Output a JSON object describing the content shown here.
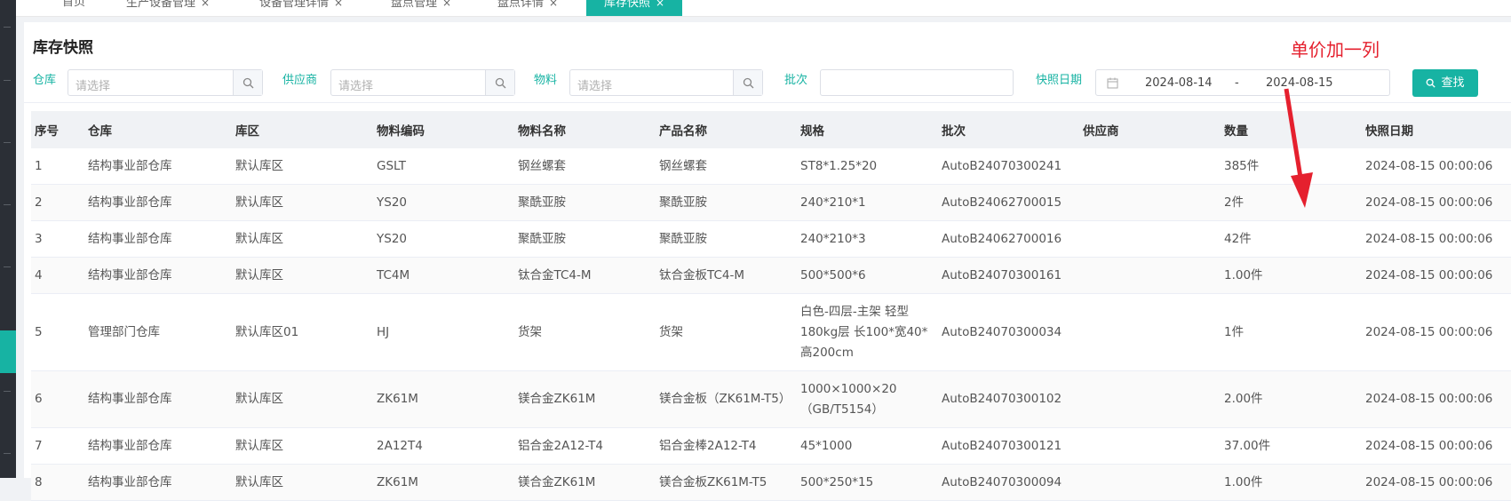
{
  "tabs": [
    {
      "label": "首页",
      "close": ""
    },
    {
      "label": "生产设备管理",
      "close": "×"
    },
    {
      "label": "设备管理详情",
      "close": "×"
    },
    {
      "label": "盘点管理",
      "close": "×"
    },
    {
      "label": "盘点详情",
      "close": "×"
    },
    {
      "label": "库存快照",
      "close": "×"
    }
  ],
  "page": {
    "title": "库存快照",
    "annotation": "单价加一列"
  },
  "filters": {
    "warehouse": {
      "label": "仓库",
      "placeholder": "请选择"
    },
    "supplier": {
      "label": "供应商",
      "placeholder": "请选择"
    },
    "material": {
      "label": "物料",
      "placeholder": "请选择"
    },
    "batch": {
      "label": "批次",
      "placeholder": ""
    },
    "snapshot_date": {
      "label": "快照日期",
      "start": "2024-08-14",
      "separator": "-",
      "end": "2024-08-15"
    },
    "search_label": "查找"
  },
  "table": {
    "headers": [
      "序号",
      "仓库",
      "库区",
      "物料编码",
      "物料名称",
      "产品名称",
      "规格",
      "批次",
      "供应商",
      "数量",
      "快照日期"
    ],
    "rows": [
      {
        "c0": "1",
        "c1": "结构事业部仓库",
        "c2": "默认库区",
        "c3": "GSLT",
        "c4": "钢丝螺套",
        "c5": "钢丝螺套",
        "c6": "ST8*1.25*20",
        "c7": "AutoB24070300241",
        "c8": "",
        "c9": "385件",
        "c10": "2024-08-15 00:00:06"
      },
      {
        "c0": "2",
        "c1": "结构事业部仓库",
        "c2": "默认库区",
        "c3": "YS20",
        "c4": "聚酰亚胺",
        "c5": "聚酰亚胺",
        "c6": "240*210*1",
        "c7": "AutoB24062700015",
        "c8": "",
        "c9": "2件",
        "c10": "2024-08-15 00:00:06"
      },
      {
        "c0": "3",
        "c1": "结构事业部仓库",
        "c2": "默认库区",
        "c3": "YS20",
        "c4": "聚酰亚胺",
        "c5": "聚酰亚胺",
        "c6": "240*210*3",
        "c7": "AutoB24062700016",
        "c8": "",
        "c9": "42件",
        "c10": "2024-08-15 00:00:06"
      },
      {
        "c0": "4",
        "c1": "结构事业部仓库",
        "c2": "默认库区",
        "c3": "TC4M",
        "c4": "钛合金TC4-M",
        "c5": "钛合金板TC4-M",
        "c6": "500*500*6",
        "c7": "AutoB24070300161",
        "c8": "",
        "c9": "1.00件",
        "c10": "2024-08-15 00:00:06"
      },
      {
        "c0": "5",
        "c1": "管理部门仓库",
        "c2": "默认库区01",
        "c3": "HJ",
        "c4": "货架",
        "c5": "货架",
        "c6": "白色-四层-主架 轻型180kg层 长100*宽40*高200cm",
        "c7": "AutoB24070300034",
        "c8": "",
        "c9": "1件",
        "c10": "2024-08-15 00:00:06"
      },
      {
        "c0": "6",
        "c1": "结构事业部仓库",
        "c2": "默认库区",
        "c3": "ZK61M",
        "c4": "镁合金ZK61M",
        "c5": "镁合金板（ZK61M-T5）",
        "c6": "1000×1000×20（GB/T5154）",
        "c7": "AutoB24070300102",
        "c8": "",
        "c9": "2.00件",
        "c10": "2024-08-15 00:00:06"
      },
      {
        "c0": "7",
        "c1": "结构事业部仓库",
        "c2": "默认库区",
        "c3": "2A12T4",
        "c4": "铝合金2A12-T4",
        "c5": "铝合金棒2A12-T4",
        "c6": "45*1000",
        "c7": "AutoB24070300121",
        "c8": "",
        "c9": "37.00件",
        "c10": "2024-08-15 00:00:06"
      },
      {
        "c0": "8",
        "c1": "结构事业部仓库",
        "c2": "默认库区",
        "c3": "ZK61M",
        "c4": "镁合金ZK61M",
        "c5": "镁合金板ZK61M-T5",
        "c6": "500*250*15",
        "c7": "AutoB24070300094",
        "c8": "",
        "c9": "1.00件",
        "c10": "2024-08-15 00:00:06"
      }
    ]
  },
  "colors": {
    "accent": "#17b3a3",
    "annotation": "#e5202e"
  }
}
